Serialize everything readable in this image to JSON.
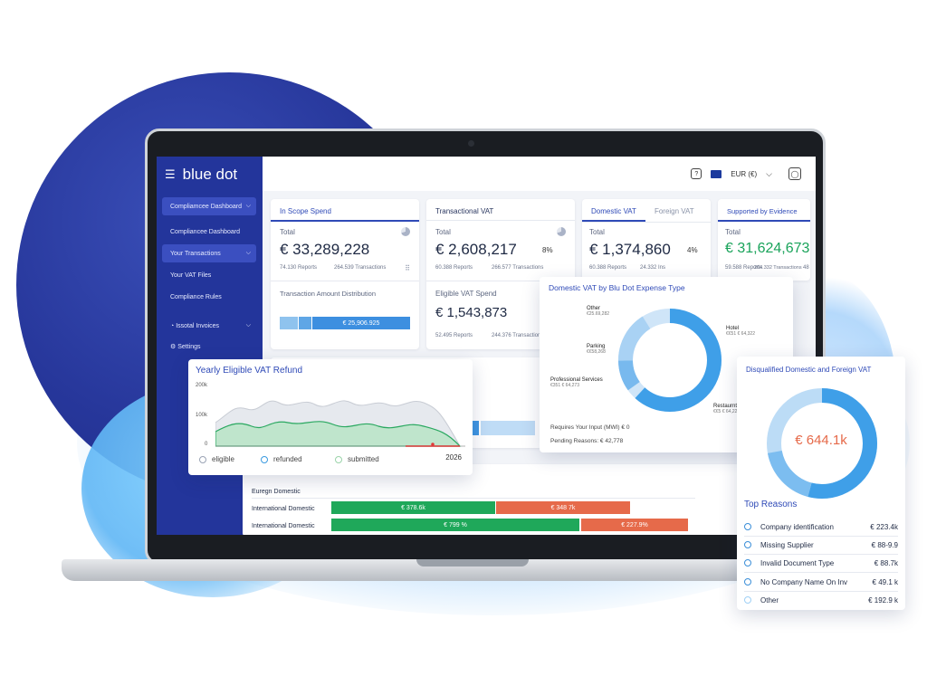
{
  "colors": {
    "brand": "#23359b",
    "accent": "#2f4ab7",
    "green": "#1fa85a",
    "orange": "#e66a4a",
    "donut": "#3f9fe8"
  },
  "app": {
    "brand_name": "blue dot",
    "currency": "EUR (€)"
  },
  "sidebar": {
    "items": [
      {
        "label": "Compliamcee Dashboard",
        "active": true,
        "chevron": "⌵"
      },
      {
        "label": "Compliancee Dashboard"
      },
      {
        "label": "Your Transactions",
        "active": true,
        "chevron": "⌵"
      },
      {
        "label": "Your VAT Files"
      },
      {
        "label": "Compliance Rules"
      },
      {
        "label": "Issotal Invoices",
        "chevron": "⌵"
      },
      {
        "label": "Settings"
      }
    ]
  },
  "cards": {
    "in_scope": {
      "tab": "In Scope Spend",
      "total_label": "Total",
      "total_value": "€ 33,289,228",
      "reports": "74.130 Reports",
      "transactions": "264.539 Transactions",
      "dist_label": "Transaction Amount Distribution",
      "dist_value": "€ 25,906.925"
    },
    "transactional": {
      "tab": "Transactional VAT",
      "total_label": "Total",
      "total_value": "€ 2,608,217",
      "pct": "8%",
      "reports": "60.388 Reports",
      "transactions": "266.577 Transactions",
      "eligible_label": "Eligible VAT Spend",
      "eligible_value": "€ 1,543,873",
      "eligible_reports": "52.495 Reports",
      "eligible_transactions": "244.376 Transactions"
    },
    "domestic": {
      "tab": "Domestic VAT",
      "tab2": "Foreign VAT",
      "total_label": "Total",
      "total_value": "€ 1,374,860",
      "pct": "4%",
      "reports": "60.388 Reports",
      "transactions": "24.332 Ins"
    },
    "supported": {
      "tab": "Supported by Evidence",
      "total_label": "Total",
      "total_value": "€ 31,624,673",
      "reports": "59.588 Reports",
      "transactions": "264.332 Transactions",
      "extra": "48"
    }
  },
  "refund": {
    "title": "Yearly Eligible VAT Refund",
    "y_ticks": [
      "200k",
      "100k",
      "0"
    ],
    "year": "2026",
    "legend": [
      "eligible",
      "refunded",
      "submitted"
    ]
  },
  "domestic_donut": {
    "title": "Domestic VAT by Blu Dot Expense Type",
    "labels": [
      {
        "name": "Other",
        "value": "€25.69,282"
      },
      {
        "name": "Hotel",
        "value": "€€51 € 64,322"
      },
      {
        "name": "Parking",
        "value": "€€58,268"
      },
      {
        "name": "Professional Services",
        "value": "€351 € 64,273"
      },
      {
        "name": "Restaurnt",
        "value": "€€5 € 64,222"
      }
    ],
    "requires_input": "Requires Your Input (MWI) € 0",
    "pending": "Pending Reasons: € 42,778"
  },
  "disqualified": {
    "title": "Disqualified Domestic and Foreign VAT",
    "center_value": "€ 644.1k",
    "reasons_title": "Top Reasons",
    "reasons": [
      {
        "label": "Company identification",
        "value": "€ 223.4k"
      },
      {
        "label": "Missing Supplier",
        "value": "€ 88-9.9"
      },
      {
        "label": "Invalid Document Type",
        "value": "€ 88.7k"
      },
      {
        "label": "No Company Name On Inv",
        "value": "€ 49.1 k"
      },
      {
        "label": "Other",
        "value": "€ 192.9 k"
      }
    ]
  },
  "bars": {
    "rows": [
      {
        "label": "Euregn Domestic"
      },
      {
        "label": "International Domestic",
        "green": "€ 378.6k",
        "orange": "€ 348 7k"
      },
      {
        "label": "International Domestic",
        "green": "€ 799 %",
        "orange": "€ 227.9%"
      }
    ]
  }
}
